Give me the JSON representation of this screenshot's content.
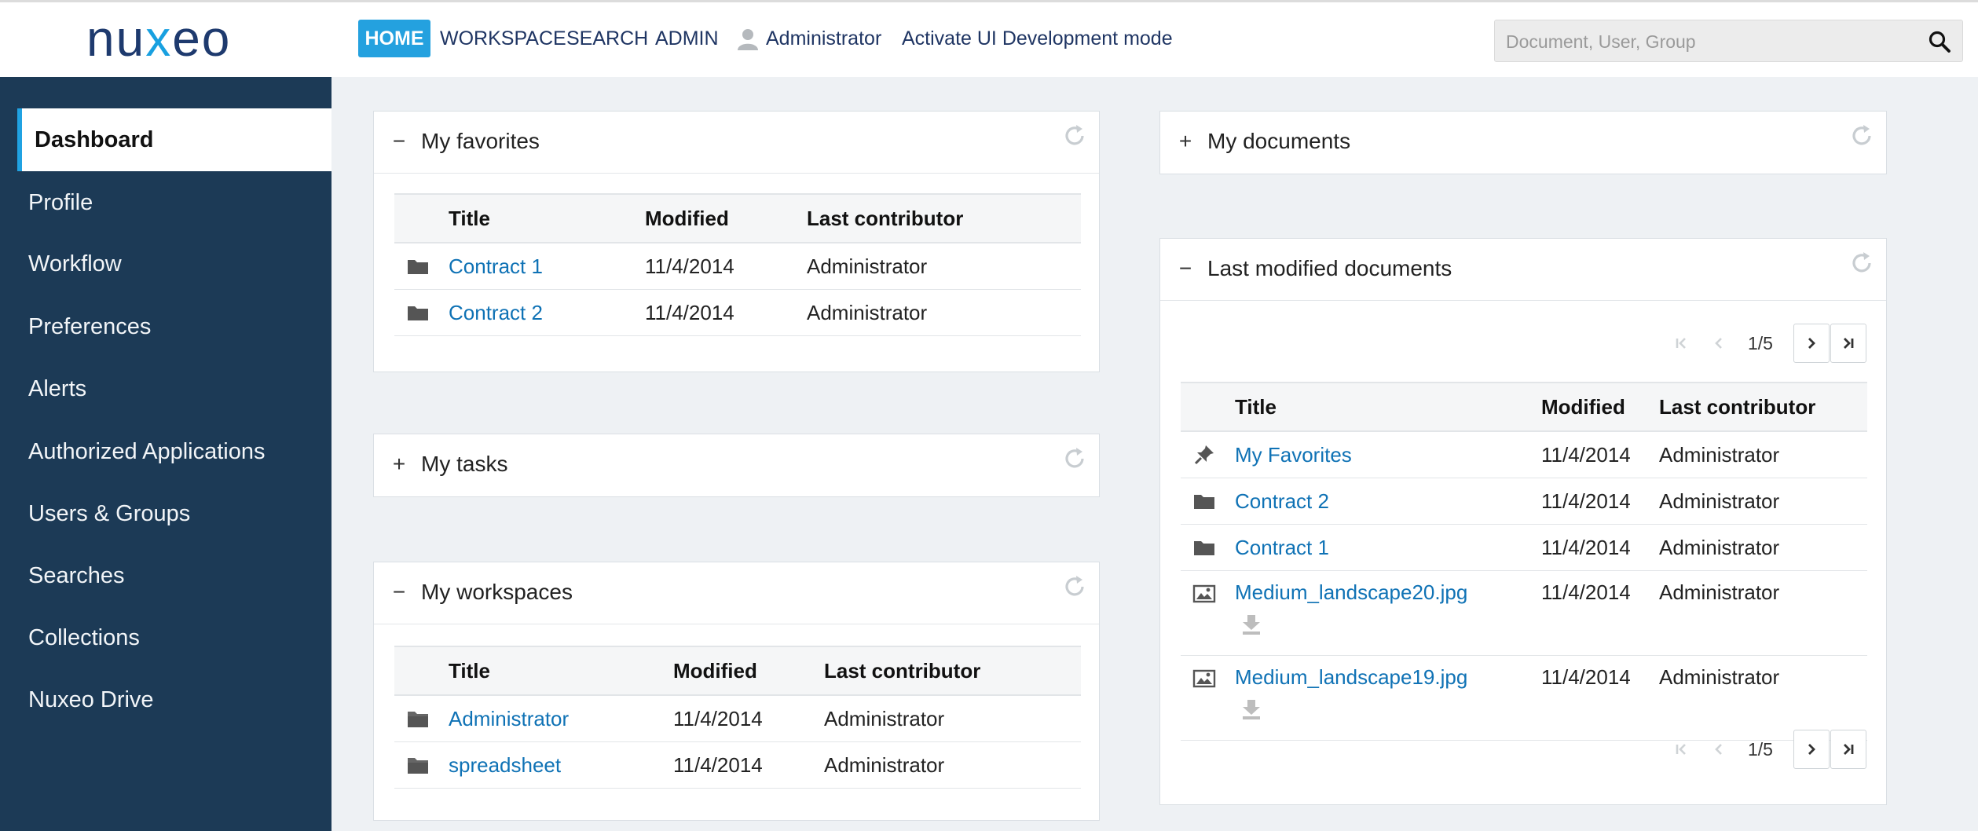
{
  "header": {
    "logo": {
      "prefix": "nu",
      "x": "x",
      "suffix": "eo"
    },
    "nav": {
      "home": "HOME",
      "workspace": "WORKSPACE",
      "search": "SEARCH",
      "admin": "ADMIN",
      "user": "Administrator",
      "devmode": "Activate UI Development mode"
    },
    "search": {
      "placeholder": "Document, User, Group",
      "value": ""
    }
  },
  "sidebar": {
    "items": [
      {
        "label": "Dashboard",
        "active": true
      },
      {
        "label": "Profile"
      },
      {
        "label": "Workflow"
      },
      {
        "label": "Preferences"
      },
      {
        "label": "Alerts"
      },
      {
        "label": "Authorized Applications"
      },
      {
        "label": "Users & Groups"
      },
      {
        "label": "Searches"
      },
      {
        "label": "Collections"
      },
      {
        "label": "Nuxeo Drive"
      }
    ]
  },
  "favorites": {
    "toggle": "−",
    "title": "My favorites",
    "columns": [
      "Title",
      "Modified",
      "Last contributor"
    ],
    "rows": [
      {
        "title": "Contract 1",
        "modified": "11/4/2014",
        "contributor": "Administrator",
        "icon": "folder-icon"
      },
      {
        "title": "Contract 2",
        "modified": "11/4/2014",
        "contributor": "Administrator",
        "icon": "folder-icon"
      }
    ]
  },
  "tasks": {
    "toggle": "+",
    "title": "My tasks"
  },
  "workspaces": {
    "toggle": "−",
    "title": "My workspaces",
    "columns": [
      "Title",
      "Modified",
      "Last contributor"
    ],
    "rows": [
      {
        "title": "Administrator",
        "modified": "11/4/2014",
        "contributor": "Administrator",
        "icon": "workspace-folder-icon"
      },
      {
        "title": "spreadsheet",
        "modified": "11/4/2014",
        "contributor": "Administrator",
        "icon": "workspace-folder-icon"
      }
    ]
  },
  "mydocs": {
    "toggle": "+",
    "title": "My documents"
  },
  "lastmodified": {
    "toggle": "−",
    "title": "Last modified documents",
    "page": "1/5",
    "columns": [
      "Title",
      "Modified",
      "Last contributor"
    ],
    "rows": [
      {
        "title": "My Favorites",
        "modified": "11/4/2014",
        "contributor": "Administrator",
        "icon": "pin-icon"
      },
      {
        "title": "Contract 2",
        "modified": "11/4/2014",
        "contributor": "Administrator",
        "icon": "folder-icon"
      },
      {
        "title": "Contract 1",
        "modified": "11/4/2014",
        "contributor": "Administrator",
        "icon": "folder-icon"
      },
      {
        "title": "Medium_landscape20.jpg",
        "modified": "11/4/2014",
        "contributor": "Administrator",
        "icon": "image-icon",
        "download": true
      },
      {
        "title": "Medium_landscape19.jpg",
        "modified": "11/4/2014",
        "contributor": "Administrator",
        "icon": "image-icon",
        "download": true
      }
    ]
  },
  "colors": {
    "accent": "#24a1df",
    "sidebar": "#1c3a56",
    "link": "#0f72b5",
    "nav": "#1f3563"
  }
}
